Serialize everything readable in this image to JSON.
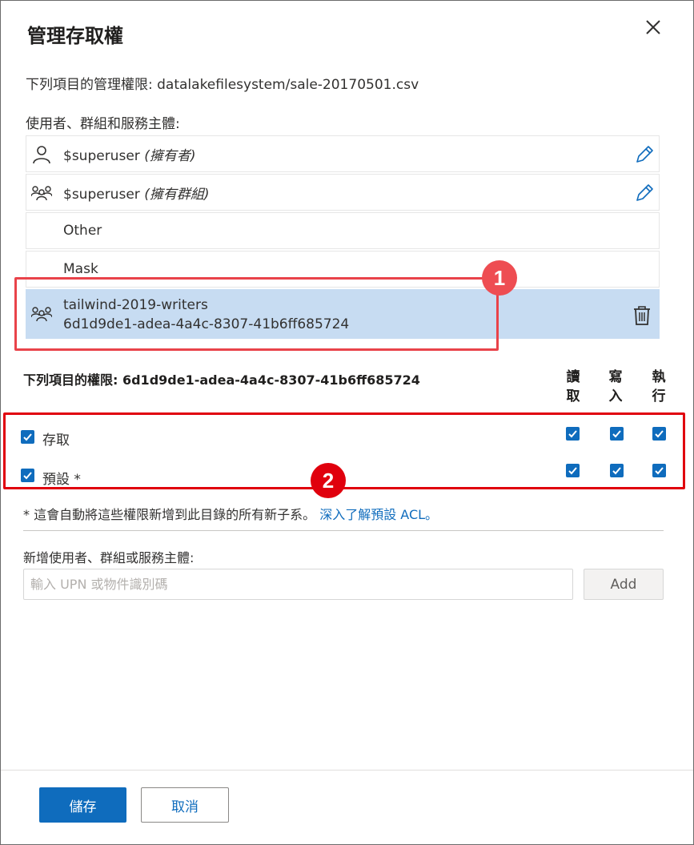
{
  "dialog": {
    "title": "管理存取權",
    "close_icon": "close-icon"
  },
  "resource": {
    "text": "下列項目的管理權限: datalakefilesystem/sale-20170501.csv"
  },
  "entities": {
    "label": "使用者、群組和服務主體:",
    "items": [
      {
        "icon": "user-icon",
        "name": "$superuser",
        "role": "(擁有者)",
        "editable": true
      },
      {
        "icon": "group-icon",
        "name": "$superuser",
        "role": "(擁有群組)",
        "editable": true
      },
      {
        "name": "Other"
      },
      {
        "name": "Mask"
      }
    ],
    "selected": {
      "icon": "group-icon",
      "name": "tailwind-2019-writers",
      "id": "6d1d9de1-adea-4a4c-8307-41b6ff685724",
      "delete_icon": "trash-icon"
    }
  },
  "callouts": {
    "one": "1",
    "two": "2",
    "color": "#e8353b"
  },
  "permissions": {
    "title": "下列項目的權限: 6d1d9de1-adea-4a4c-8307-41b6ff685724",
    "columns": {
      "read": "讀取",
      "write": "寫入",
      "execute": "執行"
    },
    "rows": [
      {
        "label": "存取",
        "enabled": true,
        "read": true,
        "write": true,
        "execute": true
      },
      {
        "label": "預設 *",
        "enabled": true,
        "read": true,
        "write": true,
        "execute": true
      }
    ]
  },
  "footnote": {
    "text": "* 這會自動將這些權限新增到此目錄的所有新子系。",
    "link": "深入了解預設 ACL。"
  },
  "add": {
    "label": "新增使用者、群組或服務主體:",
    "placeholder": "輸入 UPN 或物件識別碼",
    "button": "Add"
  },
  "footer": {
    "save": "儲存",
    "cancel": "取消"
  },
  "colors": {
    "accent": "#0f6cbd",
    "selected_row": "#c7dcf2"
  }
}
